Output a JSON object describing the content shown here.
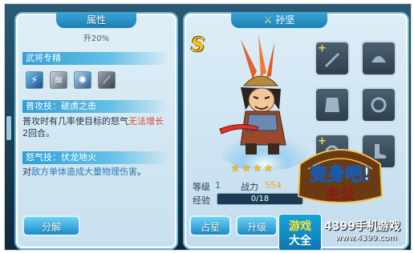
{
  "left_panel": {
    "title": "属性",
    "subtitle": "升20%",
    "section_skills": "武将专精",
    "skill_icons": [
      "lightning-skill-icon",
      "wind-skill-icon",
      "vortex-skill-icon",
      "blade-skill-icon"
    ],
    "normal_skill_title": "普攻技：破虏之击",
    "normal_skill_desc_1": "普攻时有几率使目标的怒气",
    "normal_skill_desc_red": "无法增长",
    "normal_skill_desc_2": "2回合。",
    "rage_skill_title": "怒气技：伏龙地火",
    "rage_skill_desc_1": "对",
    "rage_skill_desc_blue": "敌方单体造成大量物理伤害",
    "rage_skill_desc_2": "。",
    "decompose_button": "分解"
  },
  "right_panel": {
    "hero_name": "孙坚",
    "grade": "S",
    "stars": 4,
    "level_label": "等级",
    "level_value": "1",
    "power_label": "战力",
    "power_value": "554",
    "exp_label": "经验",
    "exp_value": "0/18",
    "star_button": "占星",
    "upgrade_button": "升级",
    "equipment_slots": [
      {
        "name": "sword-slot",
        "plus": true
      },
      {
        "name": "helmet-slot",
        "plus": false
      },
      {
        "name": "armor-slot",
        "plus": false
      },
      {
        "name": "necklace-slot",
        "plus": false
      },
      {
        "name": "ring-slot",
        "plus": true
      },
      {
        "name": "boots-slot",
        "plus": false
      }
    ]
  },
  "watermark": {
    "box_line1": "游戏",
    "box_line2": "大全",
    "title": "4399手机游戏",
    "url": "www.4399.com"
  },
  "colors": {
    "accent": "#1d7fb4",
    "gold": "#f6c21b",
    "red_text": "#e0482e"
  }
}
